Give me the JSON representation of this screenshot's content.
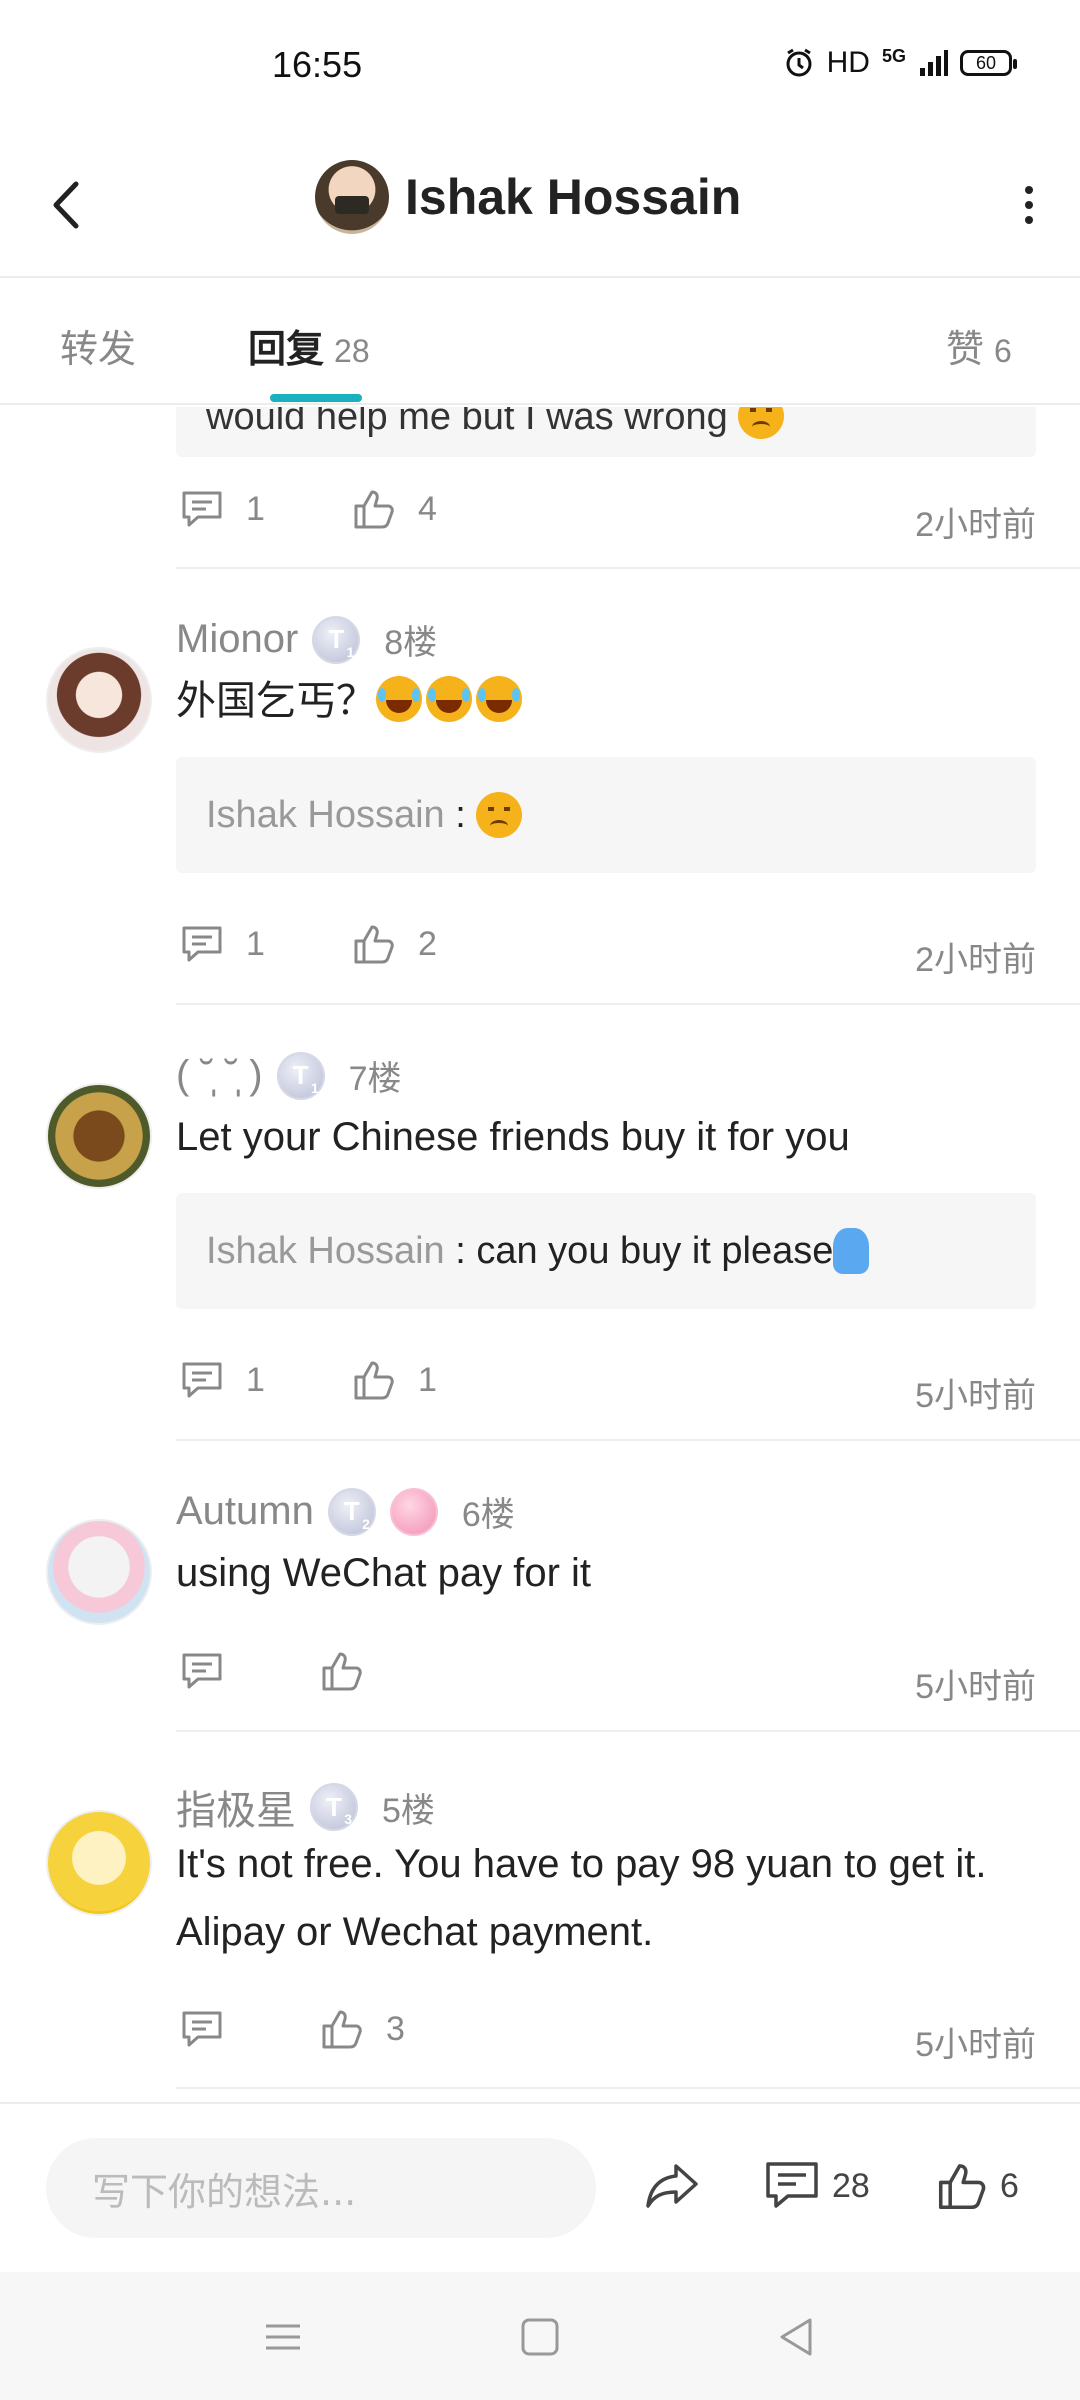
{
  "status_bar": {
    "time": "16:55",
    "network": "HD",
    "signal": "5G",
    "battery": "60"
  },
  "header": {
    "title": "Ishak Hossain"
  },
  "tabs": [
    {
      "label": "转发",
      "count": ""
    },
    {
      "label": "回复",
      "count": "28"
    },
    {
      "label": "赞",
      "count": "6"
    }
  ],
  "partial_comment": {
    "quote_tail": "would help me but I was wrong",
    "reply_count": "1",
    "like_count": "4",
    "time": "2小时前"
  },
  "comments": [
    {
      "user": "Mionor",
      "level": "1",
      "floor": "8楼",
      "text": "外国乞丐？",
      "quote_author": "Ishak Hossain",
      "quote_text": "",
      "reply_count": "1",
      "like_count": "2",
      "time": "2小时前"
    },
    {
      "user": "( ˘̩̩̩ ˘̩̩̩ )",
      "level": "1",
      "floor": "7楼",
      "text": "Let your Chinese friends buy it for you",
      "quote_author": "Ishak Hossain",
      "quote_text": "can you buy it please",
      "reply_count": "1",
      "like_count": "1",
      "time": "5小时前"
    },
    {
      "user": "Autumn",
      "level": "2",
      "floor": "6楼",
      "text": "using WeChat pay for it",
      "reply_count": "",
      "like_count": "",
      "time": "5小时前"
    },
    {
      "user": "指极星",
      "level": "3",
      "floor": "5楼",
      "text": "It's not free. You have to pay 98 yuan to get it.  Alipay or Wechat payment.",
      "reply_count": "",
      "like_count": "3",
      "time": "5小时前"
    }
  ],
  "bottom_bar": {
    "input_placeholder": "写下你的想法...",
    "reply_count": "28",
    "like_count": "6"
  },
  "colors": {
    "accent": "#1ab0c0",
    "muted_text": "#888888",
    "quote_bg": "#f6f6f6"
  }
}
